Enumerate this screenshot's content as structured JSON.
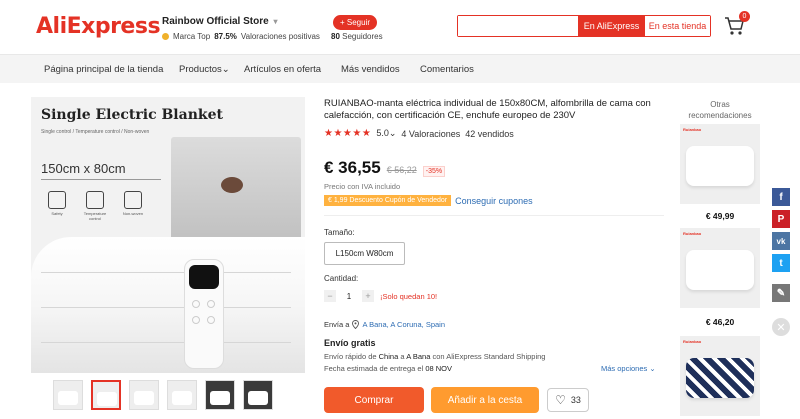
{
  "header": {
    "logo": "AliExpress",
    "store_name": "Rainbow Official Store",
    "store_caret": "▾",
    "brand_label": "Marca Top",
    "rating_pct": "87.5%",
    "rating_text": "Valoraciones positivas",
    "follow_label": "+ Seguir",
    "followers_count": "80",
    "followers_text": "Seguidores",
    "search_placeholder": "",
    "search_btn_all": "En AliExpress",
    "search_btn_store": "En esta tienda",
    "cart_count": "0"
  },
  "nav": {
    "items": [
      "Página principal de la tienda",
      "Productos",
      "Artículos en oferta",
      "Más vendidos",
      "Comentarios"
    ],
    "caret": "⌄"
  },
  "image": {
    "title": "Single Electric Blanket",
    "subtitle": "Single control / Temperature control / Non-woven",
    "size": "150cm x 80cm",
    "features": [
      "Safety",
      "Temperature control",
      "Non-woven"
    ]
  },
  "product": {
    "title": "RUIANBAO-manta eléctrica individual de 150x80CM, alfombrilla de cama con calefacción, con certificación CE, enchufe europeo de 230V",
    "stars": "★★★★★",
    "rating": "5.0",
    "rating_caret": "⌄",
    "reviews": "4 Valoraciones",
    "sold": "42 vendidos",
    "price": "€ 36,55",
    "old_price": "€ 56,22",
    "discount": "-35%",
    "vat": "Precio con IVA incluido",
    "coupon": "€ 1,99 Descuento Cupón de Vendedor",
    "coupon_link": "Conseguir cupones",
    "size_label": "Tamaño:",
    "size_option": "L150cm W80cm",
    "qty_label": "Cantidad:",
    "qty_minus": "−",
    "qty_value": "1",
    "qty_plus": "+",
    "qty_warning": "¡Solo quedan 10!",
    "ship_to_label": "Envía a",
    "ship_to_location": "A Bana, A Coruna, Spain",
    "free_shipping": "Envío gratis",
    "ship_detail_prefix": "Envío rápido de",
    "ship_from": "China",
    "ship_detail_mid": "a",
    "ship_to_city": "A Bana",
    "ship_detail_suffix": "con AliExpress Standard Shipping",
    "delivery_prefix": "Fecha estimada de entrega el",
    "delivery_date": "08 NOV",
    "more_options": "Más opciones ⌄",
    "buy_label": "Comprar",
    "cart_label": "Añadir a la cesta",
    "wish_icon": "♡",
    "wish_count": "33"
  },
  "recommendations": {
    "title": "Otras recomendaciones",
    "items": [
      {
        "brand": "Ruianbao",
        "price": "€ 49,99"
      },
      {
        "brand": "Ruianbao",
        "price": "€ 46,20"
      },
      {
        "brand": "Ruianbao",
        "price": ""
      }
    ]
  },
  "share": {
    "icons": [
      {
        "name": "facebook-icon",
        "glyph": "f",
        "color": "#3b5998"
      },
      {
        "name": "pinterest-icon",
        "glyph": "P",
        "color": "#cb2027"
      },
      {
        "name": "vk-icon",
        "glyph": "vk",
        "color": "#4c75a3"
      },
      {
        "name": "twitter-icon",
        "glyph": "t",
        "color": "#1da1f2"
      },
      {
        "name": "edit-icon",
        "glyph": "✎",
        "color": "#777777"
      }
    ],
    "close_glyph": "✕"
  },
  "colors": {
    "brand": "#e43225",
    "buy": "#f15a2b",
    "cart": "#ff9b2f",
    "link": "#2d6cb3"
  }
}
